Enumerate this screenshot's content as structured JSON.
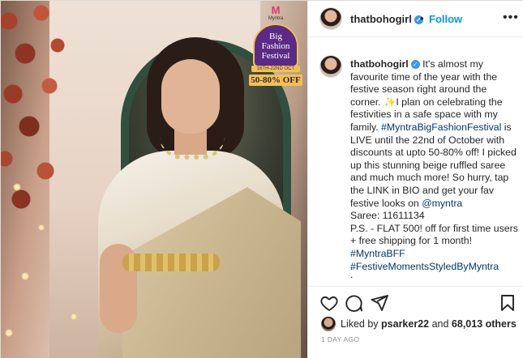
{
  "header": {
    "username": "thatbohogirl",
    "separator": "•",
    "follow_label": "Follow",
    "more_label": "•••"
  },
  "photo": {
    "badge": {
      "brand": "Myntra",
      "logo": "M",
      "title_line1": "Big",
      "title_line2": "Fashion",
      "title_line3": "Festival",
      "dates": "16TH-22ND OCT",
      "offer": "50-80% OFF"
    }
  },
  "caption": {
    "username": "thatbohogirl",
    "intro": " It's almost my favourite time of the year with the festive season right around the corner. ",
    "sparkle_emoji": "✨",
    "body1": "I plan on celebrating the festivities in a safe space with my family. ",
    "hashtag1": "#MyntraBigFashionFestival",
    "body2": " is LIVE until the 22nd of October with discounts at upto 50-80% off! I picked up this stunning beige ruffled saree and much much more! So hurry, tap the LINK in BIO and get your fav festive looks on ",
    "mention": "@myntra",
    "saree": "Saree: 11611134",
    "ps": "P.S. - FLAT 500! off for first time users + free shipping for 1 month!",
    "hashtag2": "#MyntraBFF",
    "hashtag3": "#FestiveMomentsStyledByMyntra",
    "dot1": ".",
    "dot2": "."
  },
  "actions": {
    "like_icon": "heart-icon",
    "comment_icon": "comment-icon",
    "share_icon": "paper-plane-icon",
    "save_icon": "bookmark-icon"
  },
  "likes": {
    "prefix": "Liked by ",
    "user": "psarker22",
    "middle": " and ",
    "count": "68,013 others"
  },
  "timestamp": "1 DAY AGO",
  "colors": {
    "link_blue": "#0095f6",
    "hashtag_blue": "#00376b",
    "verified_blue": "#3897f0",
    "badge_purple": "#5b2a86",
    "badge_gold": "#f2c14e"
  }
}
